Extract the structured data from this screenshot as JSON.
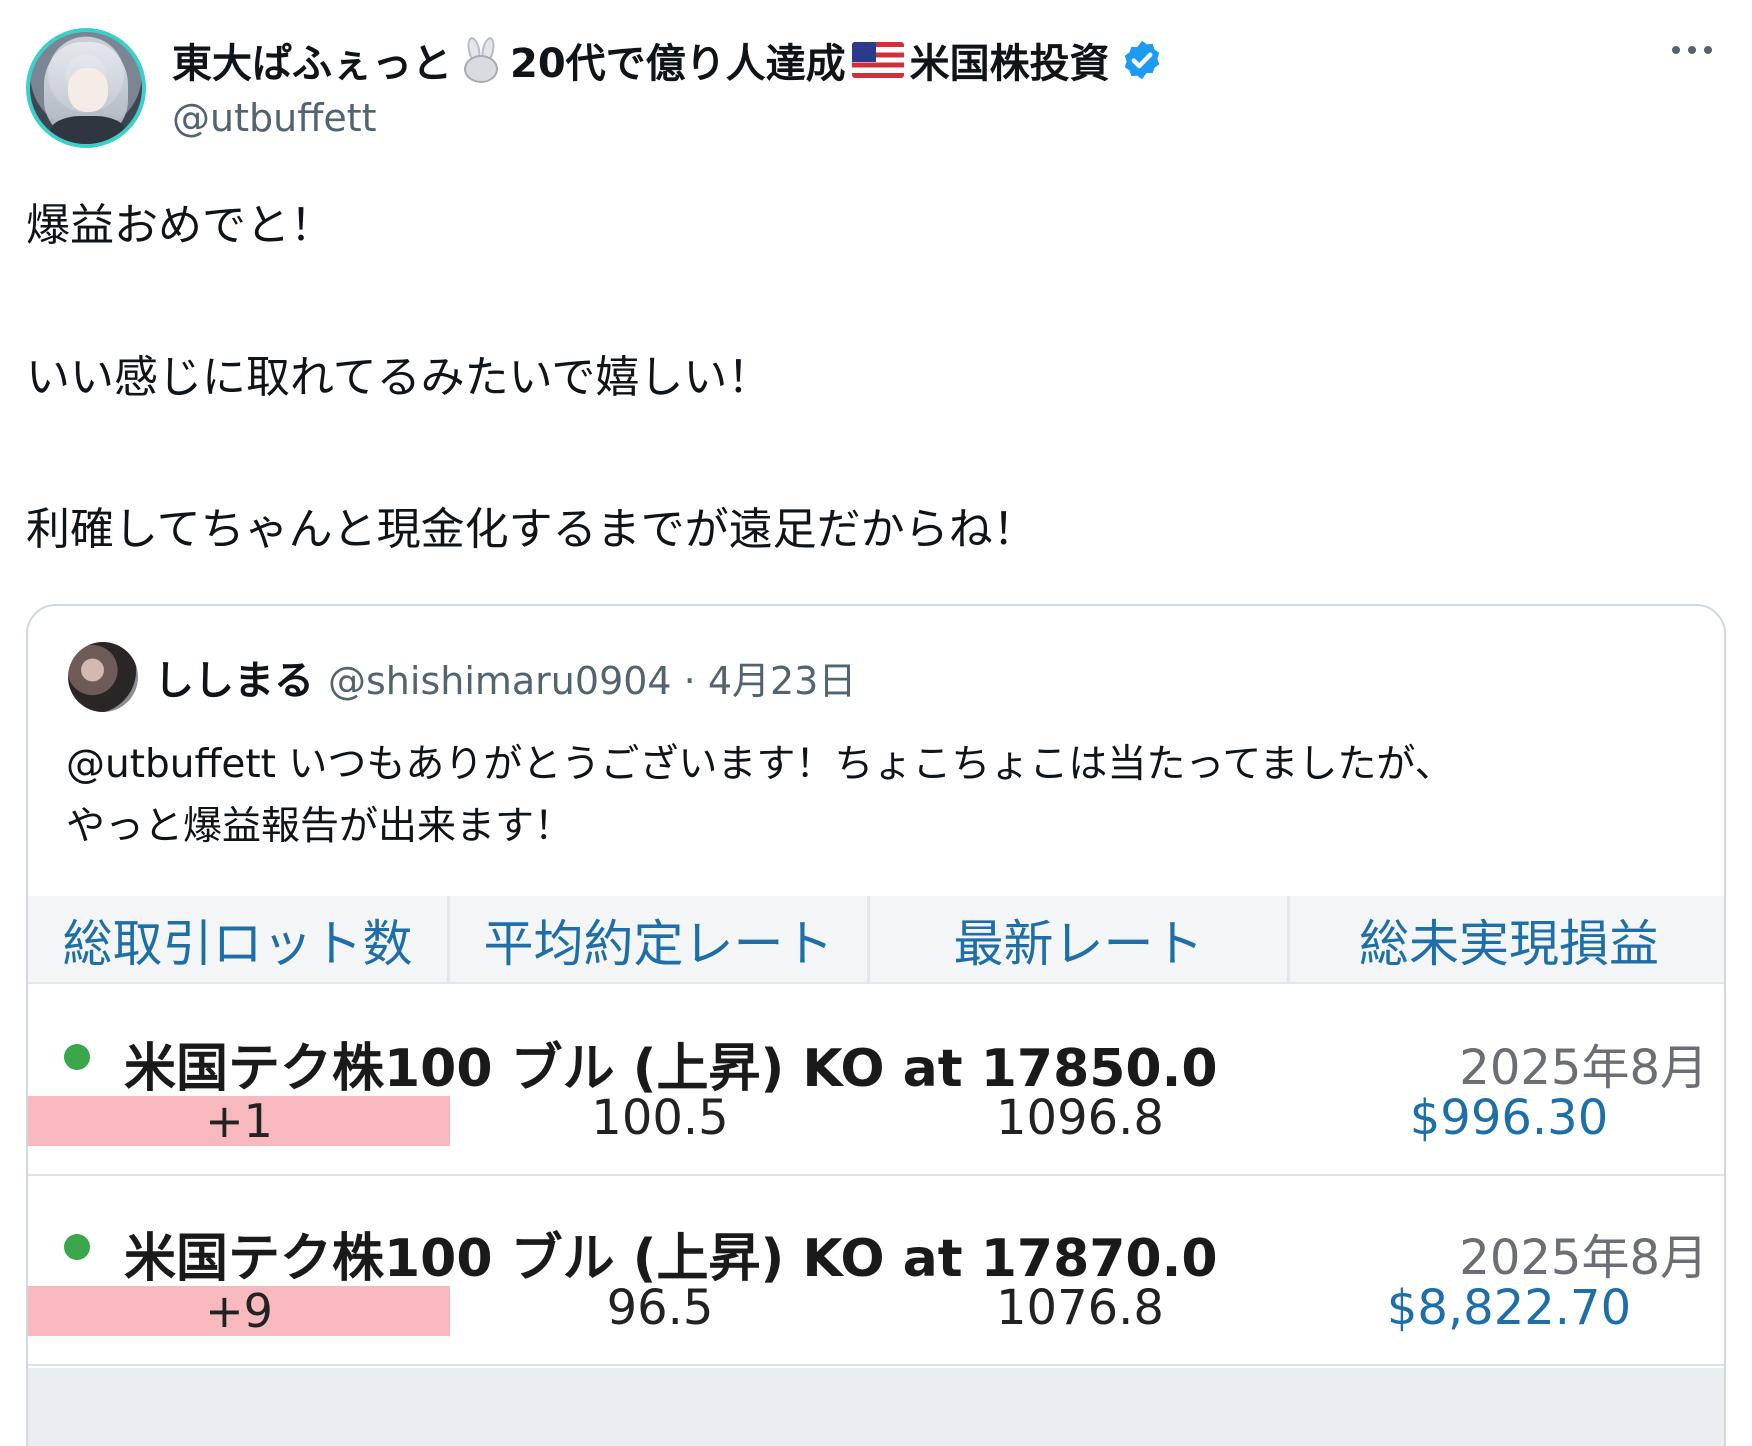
{
  "author": {
    "display_name_part1": "東大ぱふぇっと",
    "display_name_part2": "20代で億り人達成",
    "display_name_part3": "米国株投資",
    "handle": "@utbuffett",
    "icons": [
      "rabbit-icon",
      "us-flag-icon",
      "verified-badge-icon"
    ]
  },
  "tweet": {
    "lines": [
      "爆益おめでと！",
      "いい感じに取れてるみたいで嬉しい！",
      "利確してちゃんと現金化するまでが遠足だからね！"
    ]
  },
  "quote": {
    "name": "ししまる",
    "meta": "@shishimaru0904 · 4月23日",
    "body_lines": [
      "@utbuffett いつもありがとうございます！ちょこちょこは当たってましたが、",
      "やっと爆益報告が出来ます！"
    ],
    "table": {
      "headers": [
        "総取引ロット数",
        "平均約定レート",
        "最新レート",
        "総未実現損益"
      ],
      "rows": [
        {
          "instrument": "米国テク株100 ブル (上昇) KO at 17850.0",
          "date": "2025年8月",
          "lots": "+1",
          "avg_rate": "100.5",
          "latest_rate": "1096.8",
          "pnl": "$996.30"
        },
        {
          "instrument": "米国テク株100 ブル (上昇) KO at 17870.0",
          "date": "2025年8月",
          "lots": "+9",
          "avg_rate": "96.5",
          "latest_rate": "1076.8",
          "pnl": "$8,822.70"
        }
      ]
    }
  },
  "colors": {
    "verified": "#1d9bf0",
    "header_text": "#1e6fa8",
    "lot_highlight": "#f7b9bd",
    "status_dot": "#3aa84a"
  }
}
